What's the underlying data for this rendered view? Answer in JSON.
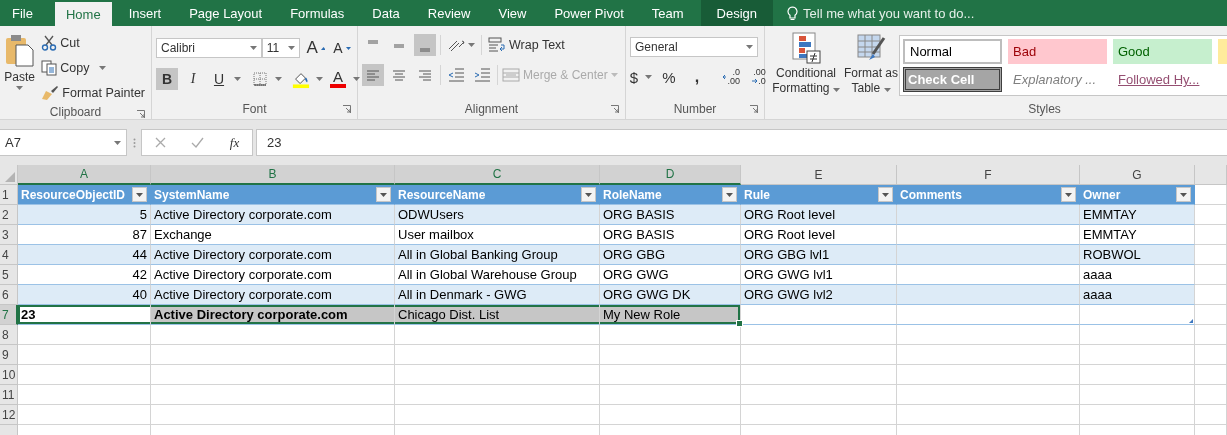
{
  "tabs": [
    {
      "label": "File",
      "selected": false,
      "kind": "file"
    },
    {
      "label": "Home",
      "selected": true,
      "kind": "normal"
    },
    {
      "label": "Insert",
      "selected": false,
      "kind": "normal"
    },
    {
      "label": "Page Layout",
      "selected": false,
      "kind": "normal"
    },
    {
      "label": "Formulas",
      "selected": false,
      "kind": "normal"
    },
    {
      "label": "Data",
      "selected": false,
      "kind": "normal"
    },
    {
      "label": "Review",
      "selected": false,
      "kind": "normal"
    },
    {
      "label": "View",
      "selected": false,
      "kind": "normal"
    },
    {
      "label": "Power Pivot",
      "selected": false,
      "kind": "normal"
    },
    {
      "label": "Team",
      "selected": false,
      "kind": "normal"
    },
    {
      "label": "Design",
      "selected": false,
      "kind": "contextual"
    }
  ],
  "tell_me": "Tell me what you want to do...",
  "ribbon": {
    "clipboard": {
      "paste": "Paste",
      "cut": "Cut",
      "copy": "Copy",
      "format_painter": "Format Painter",
      "label": "Clipboard"
    },
    "font": {
      "name": "Calibri",
      "size": "11",
      "grow": "A",
      "shrink": "A",
      "bold": {
        "text": "B",
        "selected": true
      },
      "italic": "I",
      "underline": "U",
      "font_color": "A",
      "label": "Font"
    },
    "alignment": {
      "vertical": [
        {
          "selected": false
        },
        {
          "selected": false
        },
        {
          "selected": true
        }
      ],
      "horizontal": [
        {
          "selected": true
        },
        {
          "selected": false
        },
        {
          "selected": false
        }
      ],
      "wrap_text": "Wrap Text",
      "merge": {
        "label": "Merge & Center",
        "disabled": true
      },
      "label": "Alignment"
    },
    "number": {
      "format": "General",
      "currency": "$",
      "percent": "%",
      "comma": ",",
      "increase_decimal": {
        "top": ".0",
        "bottom": ".00"
      },
      "decrease_decimal": {
        "top": ".00",
        "bottom": ".0"
      },
      "label": "Number"
    },
    "styles": {
      "conditional": "Conditional Formatting",
      "format_table": "Format as Table",
      "label": "Styles",
      "cells": [
        {
          "label": "Normal",
          "kind": "normal"
        },
        {
          "label": "Bad",
          "kind": "bad"
        },
        {
          "label": "Good",
          "kind": "good"
        },
        {
          "kind": "neutral"
        },
        {
          "label": "Check Cell",
          "kind": "check"
        },
        {
          "label": "Explanatory ...",
          "kind": "explanatory"
        },
        {
          "label": "Followed Hy...",
          "kind": "followed"
        }
      ]
    }
  },
  "formula_bar": {
    "name_box": "A7",
    "fx": "fx",
    "formula": "23"
  },
  "sheet": {
    "columns": [
      {
        "letter": "A",
        "selected": true
      },
      {
        "letter": "B",
        "selected": true
      },
      {
        "letter": "C",
        "selected": true
      },
      {
        "letter": "D",
        "selected": true
      },
      {
        "letter": "E",
        "selected": false
      },
      {
        "letter": "F",
        "selected": false
      },
      {
        "letter": "G",
        "selected": false
      }
    ],
    "row_numbers": [
      {
        "label": "1",
        "selected": false
      },
      {
        "label": "2",
        "selected": false
      },
      {
        "label": "3",
        "selected": false
      },
      {
        "label": "4",
        "selected": false
      },
      {
        "label": "5",
        "selected": false
      },
      {
        "label": "6",
        "selected": false
      },
      {
        "label": "7",
        "selected": true
      },
      {
        "label": "8",
        "selected": false
      },
      {
        "label": "9",
        "selected": false
      },
      {
        "label": "10",
        "selected": false
      },
      {
        "label": "11",
        "selected": false
      },
      {
        "label": "12",
        "selected": false
      }
    ],
    "table": {
      "headers": [
        "ResourceObjectID",
        "SystemName",
        "ResourceName",
        "RoleName",
        "Rule",
        "Comments",
        "Owner"
      ],
      "rows": [
        {
          "kind": "record",
          "cells": [
            "5",
            "Active Directory corporate.com",
            "ODWUsers",
            "ORG BASIS",
            "ORG Root level",
            null,
            "EMMTAY"
          ]
        },
        {
          "kind": "record",
          "cells": [
            "87",
            "Exchange",
            "User mailbox",
            "ORG BASIS",
            "ORG Root level",
            null,
            "EMMTAY"
          ]
        },
        {
          "kind": "record",
          "cells": [
            "44",
            "Active Directory corporate.com",
            "All in Global Banking Group",
            "ORG GBG",
            "ORG GBG lvl1",
            null,
            "ROBWOL"
          ]
        },
        {
          "kind": "record",
          "cells": [
            "42",
            "Active Directory corporate.com",
            "All in Global Warehouse Group",
            "ORG GWG",
            "ORG GWG lvl1",
            null,
            "aaaa"
          ]
        },
        {
          "kind": "record",
          "cells": [
            "40",
            "Active Directory corporate.com",
            "All in Denmark - GWG",
            "ORG GWG DK",
            "ORG GWG lvl2",
            null,
            "aaaa"
          ]
        },
        {
          "kind": "entry",
          "cells": [
            "23",
            "Active Directory corporate.com",
            "Chicago Dist. List",
            "My New Role",
            null,
            null,
            null
          ],
          "bold": [
            true,
            true,
            false,
            false,
            false,
            false,
            false
          ]
        }
      ]
    }
  }
}
